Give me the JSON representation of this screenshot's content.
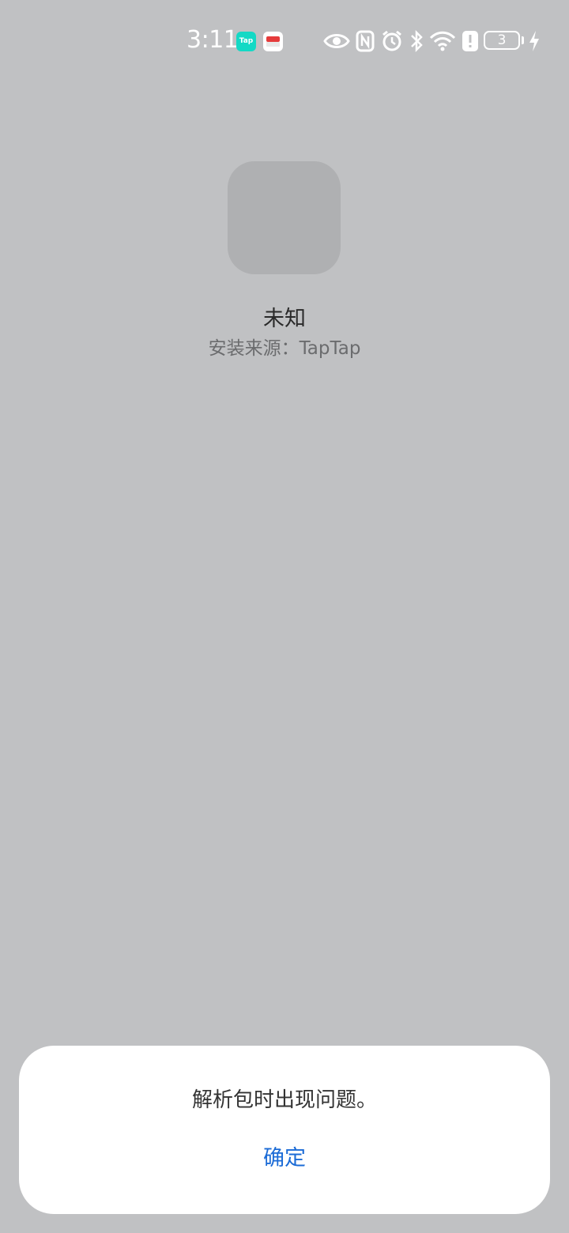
{
  "status_bar": {
    "time": "3:11",
    "notification_icons": [
      "taptap-icon",
      "red-app-icon"
    ],
    "taptap_badge_text": "Tap",
    "system_icons": [
      "eye-icon",
      "nfc-icon",
      "alarm-icon",
      "bluetooth-icon",
      "wifi-icon",
      "alert-icon",
      "battery-icon",
      "charging-icon"
    ],
    "battery_level": "3"
  },
  "app_info": {
    "name": "未知",
    "install_source": "安装来源：TapTap"
  },
  "dialog": {
    "message": "解析包时出现问题。",
    "confirm_label": "确定"
  },
  "colors": {
    "background": "#c0c1c3",
    "accent": "#1b6bd6",
    "taptap": "#14d9c5"
  }
}
